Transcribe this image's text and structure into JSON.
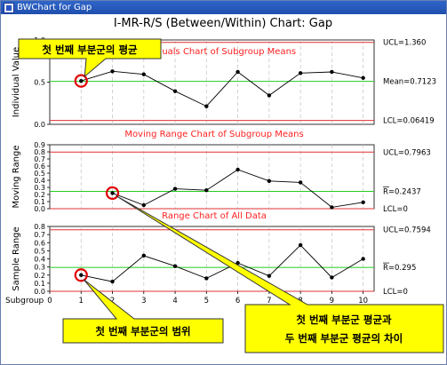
{
  "window": {
    "title": "BWChart for Gap"
  },
  "chart_main_title": "I-MR-R/S (Between/Within) Chart: Gap",
  "x_axis_label": "Subgroup",
  "colors": {
    "limit_line": "#e03030",
    "center_line": "#22cc22",
    "series": "#000000",
    "highlight": "#e00000",
    "callout_fill": "#ffff00",
    "subtitle": "#ff2020",
    "titlebar": "#2a5bc0"
  },
  "chart_data": [
    {
      "type": "line",
      "title": "Individuals Chart of Subgroup Means",
      "ylabel": "Individual Value",
      "x": [
        1,
        2,
        3,
        4,
        5,
        6,
        7,
        8,
        9,
        10
      ],
      "values": [
        0.72,
        0.88,
        0.83,
        0.55,
        0.3,
        0.87,
        0.48,
        0.85,
        0.87,
        0.77
      ],
      "ylim": [
        0,
        1.4
      ],
      "yticks": [
        "0.0",
        "0.5",
        "1.0"
      ],
      "ucl": 1.36,
      "center": 0.7123,
      "lcl": 0.06419,
      "ucl_label": "UCL=1.360",
      "center_label": "Mean=0.7123",
      "lcl_label": "LCL=0.06419"
    },
    {
      "type": "line",
      "title": "Moving Range Chart of Subgroup Means",
      "ylabel": "Moving Range",
      "x": [
        2,
        3,
        4,
        5,
        6,
        7,
        8,
        9,
        10
      ],
      "values": [
        0.22,
        0.05,
        0.28,
        0.26,
        0.55,
        0.39,
        0.37,
        0.02,
        0.09
      ],
      "ylim": [
        0,
        0.9
      ],
      "yticks": [
        "0.0",
        "0.1",
        "0.2",
        "0.3",
        "0.4",
        "0.5",
        "0.6",
        "0.7",
        "0.8",
        "0.9"
      ],
      "ucl": 0.7963,
      "center": 0.2437,
      "lcl": 0,
      "ucl_label": "UCL=0.7963",
      "center_label": "R=0.2437",
      "lcl_label": "LCL=0"
    },
    {
      "type": "line",
      "title": "Range Chart of All Data",
      "ylabel": "Sample Range",
      "x": [
        1,
        2,
        3,
        4,
        5,
        6,
        7,
        8,
        9,
        10
      ],
      "values": [
        0.2,
        0.12,
        0.44,
        0.31,
        0.16,
        0.35,
        0.19,
        0.57,
        0.17,
        0.4
      ],
      "ylim": [
        0,
        0.8
      ],
      "yticks": [
        "0.0",
        "0.1",
        "0.2",
        "0.3",
        "0.4",
        "0.5",
        "0.6",
        "0.7",
        "0.8"
      ],
      "ucl": 0.7594,
      "center": 0.295,
      "lcl": 0,
      "ucl_label": "UCL=0.7594",
      "center_label": "R=0.295",
      "lcl_label": "LCL=0"
    }
  ],
  "x_ticks": [
    "0",
    "1",
    "2",
    "3",
    "4",
    "5",
    "6",
    "7",
    "8",
    "9",
    "10"
  ],
  "callouts": {
    "first_mean": "첫 번째 부분군의 평균",
    "first_range": "첫 번째 부분군의 범위",
    "mr_line1": "첫 번째 부분군 평균과",
    "mr_line2": "두 번째 부분군 평균의 차이"
  }
}
